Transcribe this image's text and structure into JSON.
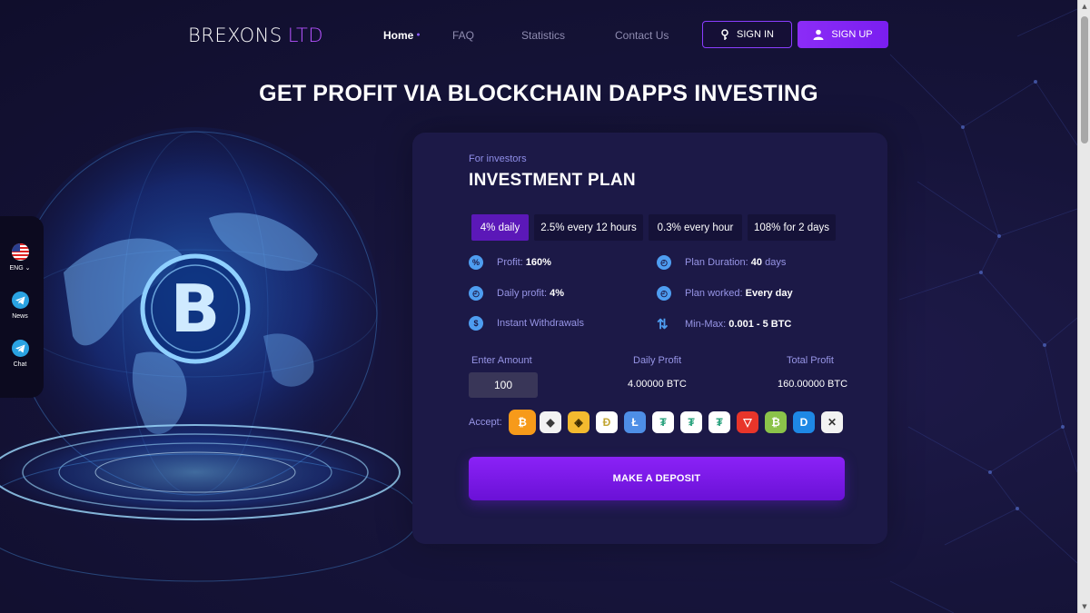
{
  "brand": {
    "name": "BREXONS",
    "suffix": "LTD"
  },
  "nav": {
    "home": "Home",
    "faq": "FAQ",
    "statistics": "Statistics",
    "contact": "Contact Us"
  },
  "auth": {
    "signin": "SIGN IN",
    "signup": "SIGN UP"
  },
  "hero": {
    "headline": "GET PROFIT VIA BLOCKCHAIN DAPPS INVESTING"
  },
  "sidebar": {
    "language": "ENG",
    "news": "News",
    "chat": "Chat"
  },
  "plan": {
    "subtitle": "For investors",
    "title": "INVESTMENT PLAN",
    "tabs": [
      "4% daily",
      "2.5% every 12 hours",
      "0.3% every hour",
      "108% for 2 days"
    ],
    "selected_tab": "4% daily",
    "features": {
      "profit_label": "Profit:",
      "profit_value": "160%",
      "daily_label": "Daily profit:",
      "daily_value": "4%",
      "withdrawals": "Instant Withdrawals",
      "duration_label": "Plan Duration:",
      "duration_value": "40",
      "duration_unit": "days",
      "worked_label": "Plan worked:",
      "worked_value": "Every day",
      "minmax_label": "Min-Max:",
      "minmax_value": "0.001 - 5 BTC"
    },
    "calculator": {
      "amount_label": "Enter Amount",
      "amount_value": "100",
      "daily_label": "Daily Profit",
      "daily_value": "4.00000 BTC",
      "total_label": "Total Profit",
      "total_value": "160.00000 BTC"
    },
    "accept_label": "Accept:",
    "coins": [
      "bitcoin-icon",
      "ethereum-icon",
      "binance-icon",
      "dogecoin-icon",
      "litecoin-icon",
      "tether-icon",
      "tether-icon",
      "tether-icon",
      "tron-icon",
      "bitcoin-cash-icon",
      "dash-icon",
      "ripple-icon"
    ],
    "deposit_button": "MAKE A DEPOSIT"
  },
  "colors": {
    "accent": "#8b2cf6",
    "card": "#1c1947",
    "background": "#16143a",
    "label": "#9795e6"
  }
}
